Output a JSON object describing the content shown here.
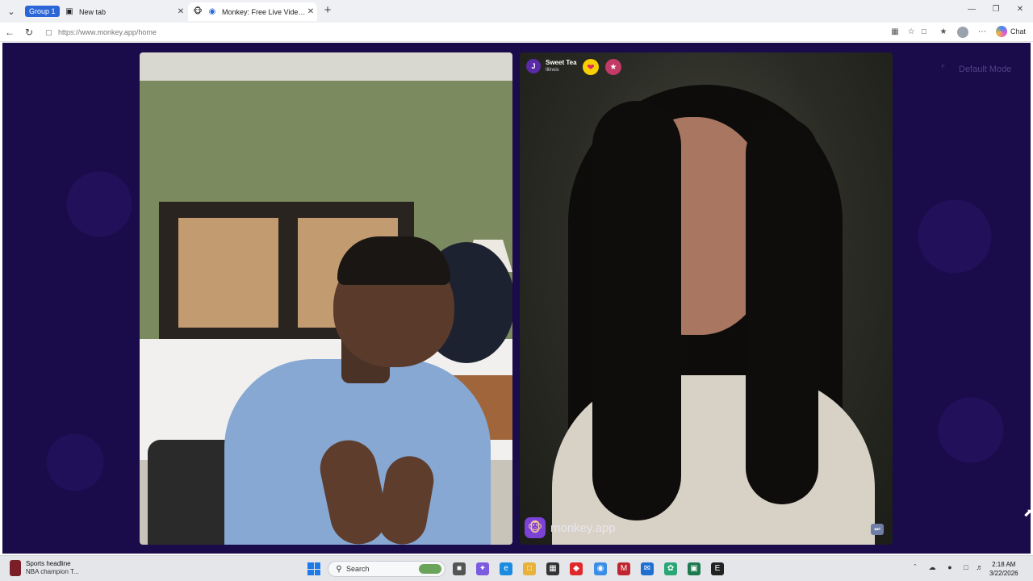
{
  "browser": {
    "tab_group_label": "Group 1",
    "tabs": [
      {
        "label": "New tab"
      },
      {
        "label": "Monkey: Free Live Video Chat"
      }
    ],
    "url": "https://www.monkey.app/home",
    "copilot_label": "Chat"
  },
  "page": {
    "mode_label": "Default Mode",
    "peer": {
      "initial": "J",
      "name": "Sweet Tea",
      "location": "Illinois"
    },
    "brand_label": "monkey.app",
    "colors": {
      "background": "#1a0b4a",
      "heart_button": "#f6d000",
      "brand_purple": "#7b42d6"
    }
  },
  "taskbar": {
    "news_title": "Sports headline",
    "news_subtitle": "NBA champion T...",
    "search_placeholder": "Search",
    "time": "2:18 AM",
    "date": "3/22/2026"
  }
}
